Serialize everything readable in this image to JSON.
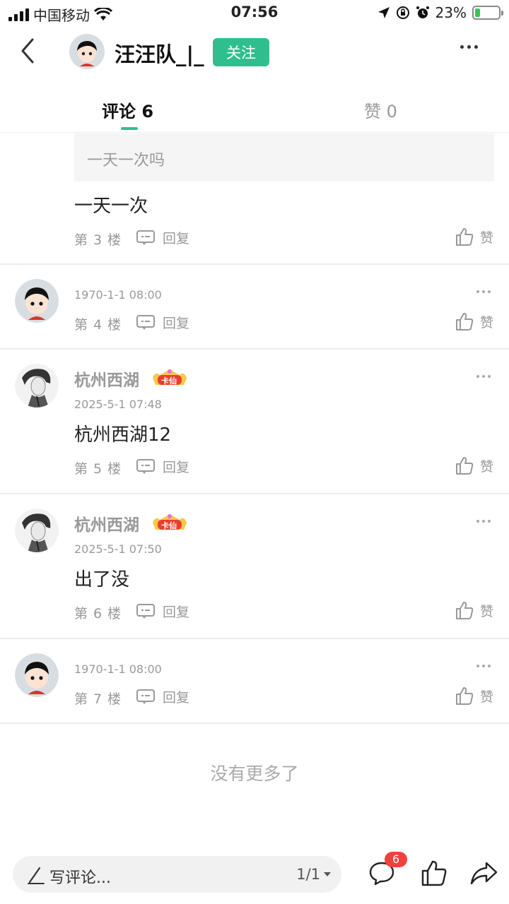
{
  "status_bar": {
    "carrier": "中国移动",
    "time": "07:56",
    "battery": "23%",
    "battery_level": 0.23
  },
  "header": {
    "username": "汪汪队_|_",
    "follow_label": "关注"
  },
  "tabs": [
    {
      "label": "评论 6",
      "active": true
    },
    {
      "label": "赞 0",
      "active": false
    }
  ],
  "comments": [
    {
      "quote": "一天一次吗",
      "text": "一天一次",
      "floor": "第 3 楼",
      "reply_label": "回复",
      "like_label": "赞"
    },
    {
      "time": "1970-1-1 08:00",
      "floor": "第 4 楼",
      "reply_label": "回复",
      "like_label": "赞"
    },
    {
      "name": "杭州西湖",
      "badge": "卡仙",
      "time": "2025-5-1 07:48",
      "text": "杭州西湖12",
      "floor": "第 5 楼",
      "reply_label": "回复",
      "like_label": "赞"
    },
    {
      "name": "杭州西湖",
      "badge": "卡仙",
      "time": "2025-5-1 07:50",
      "text": "出了没",
      "floor": "第 6 楼",
      "reply_label": "回复",
      "like_label": "赞"
    },
    {
      "time": "1970-1-1 08:00",
      "floor": "第 7 楼",
      "reply_label": "回复",
      "like_label": "赞"
    }
  ],
  "list_end_text": "没有更多了",
  "bottom_bar": {
    "placeholder": "写评论...",
    "page_indicator": "1/1",
    "comment_count": "6"
  },
  "colors": {
    "accent": "#2fbf8f",
    "badge_red": "#f0413c",
    "muted": "#999999"
  }
}
